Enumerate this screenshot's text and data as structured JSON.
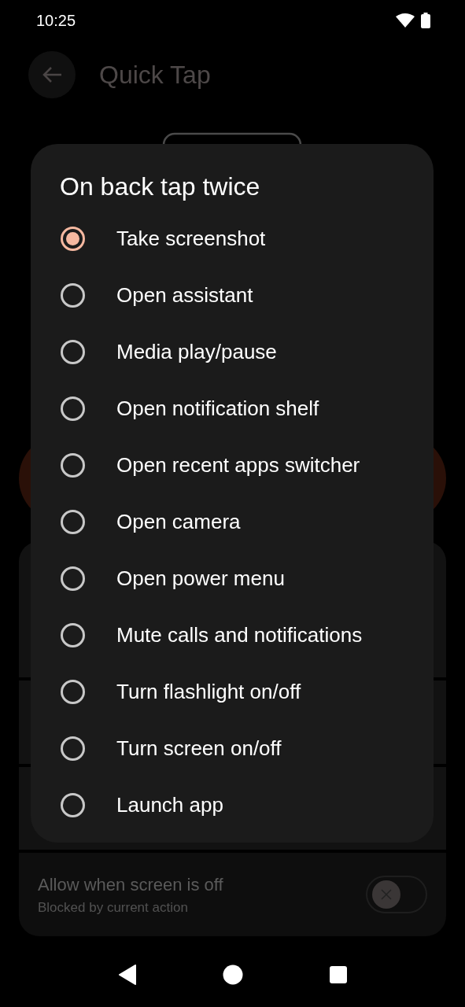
{
  "status_bar": {
    "time": "10:25"
  },
  "app_bar": {
    "title": "Quick Tap"
  },
  "setting": {
    "title": "Allow when screen is off",
    "subtitle": "Blocked by current action",
    "on": false,
    "disabled": true
  },
  "dialog": {
    "title": "On back tap twice",
    "options": [
      {
        "label": "Take screenshot",
        "selected": true
      },
      {
        "label": "Open assistant",
        "selected": false
      },
      {
        "label": "Media play/pause",
        "selected": false
      },
      {
        "label": "Open notification shelf",
        "selected": false
      },
      {
        "label": "Open recent apps switcher",
        "selected": false
      },
      {
        "label": "Open camera",
        "selected": false
      },
      {
        "label": "Open power menu",
        "selected": false
      },
      {
        "label": "Mute calls and notifications",
        "selected": false
      },
      {
        "label": "Turn flashlight on/off",
        "selected": false
      },
      {
        "label": "Turn screen on/off",
        "selected": false
      },
      {
        "label": "Launch app",
        "selected": false
      }
    ]
  }
}
